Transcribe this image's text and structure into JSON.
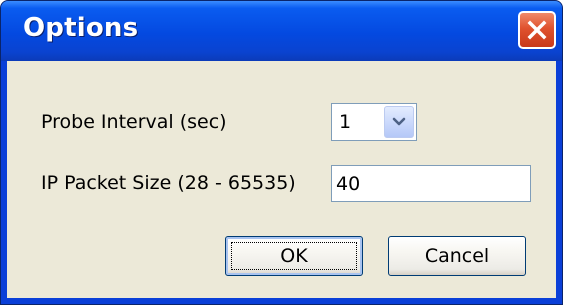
{
  "window": {
    "title": "Options"
  },
  "form": {
    "probe_interval": {
      "label": "Probe Interval (sec)",
      "value": "1"
    },
    "packet_size": {
      "label": "IP Packet Size (28 - 65535)",
      "value": "40"
    }
  },
  "buttons": {
    "ok": "OK",
    "cancel": "Cancel"
  },
  "icons": {
    "close": "close-icon",
    "dropdown": "chevron-down-icon"
  },
  "colors": {
    "titlebar": "#0449e0",
    "close_button": "#e0522e",
    "client_background": "#ece9d8"
  }
}
